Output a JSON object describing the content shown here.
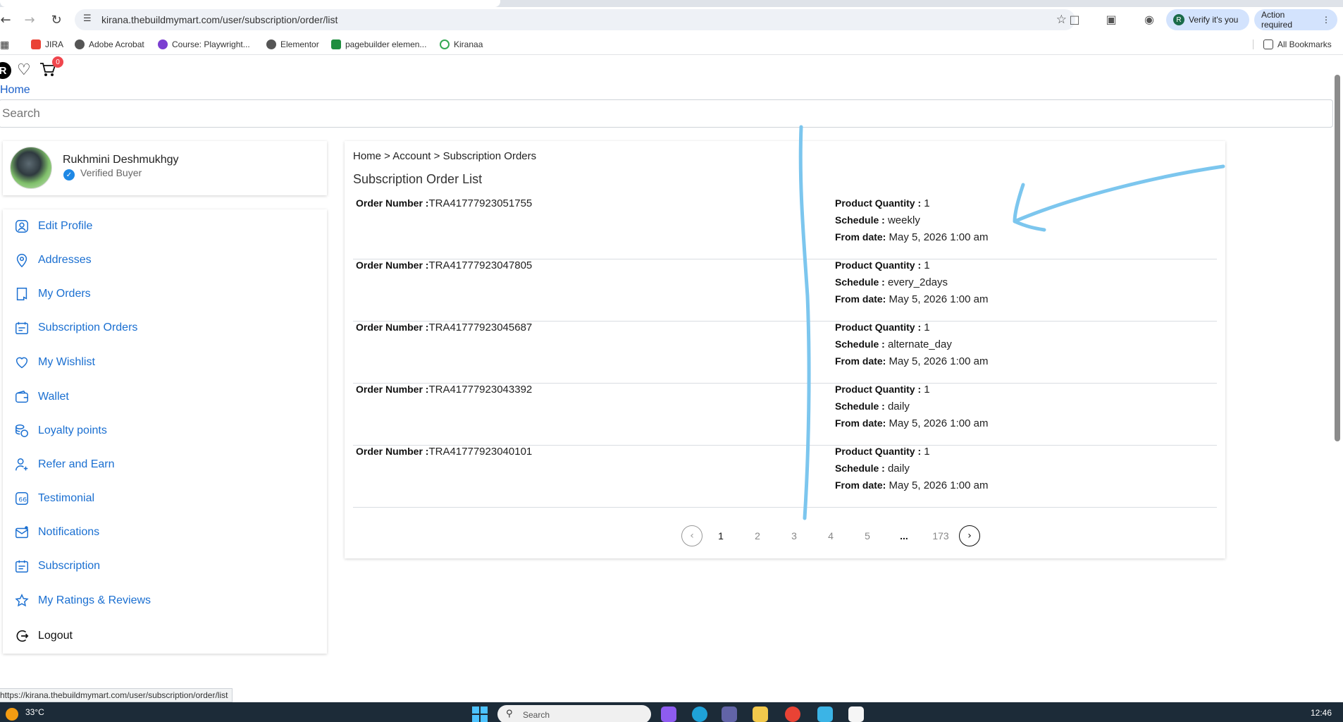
{
  "browser": {
    "url": "kirana.thebuildmymart.com/user/subscription/order/list",
    "verify_label": "Verify it's you",
    "verify_avatar": "R",
    "action_label": "Action required",
    "bookmarks": [
      "JIRA",
      "Adobe Acrobat",
      "Course: Playwright...",
      "Elementor",
      "pagebuilder elemen...",
      "Kiranaa"
    ],
    "all_bookmarks": "All Bookmarks",
    "status_url": "https://kirana.thebuildmymart.com/user/subscription/order/list"
  },
  "header": {
    "logo_letter": "R",
    "cart_count": "0",
    "home_link": "Home",
    "search_placeholder": "Search"
  },
  "profile": {
    "name": "Rukhmini Deshmukhgy",
    "badge": "Verified Buyer"
  },
  "sidebar": {
    "items": [
      {
        "label": "Edit Profile",
        "icon": "user-icon"
      },
      {
        "label": "Addresses",
        "icon": "location-pin-icon"
      },
      {
        "label": "My Orders",
        "icon": "orders-icon"
      },
      {
        "label": "Subscription Orders",
        "icon": "subscription-orders-icon"
      },
      {
        "label": "My Wishlist",
        "icon": "heart-icon"
      },
      {
        "label": "Wallet",
        "icon": "wallet-icon"
      },
      {
        "label": "Loyalty points",
        "icon": "coins-icon"
      },
      {
        "label": "Refer and Earn",
        "icon": "refer-icon"
      },
      {
        "label": "Testimonial",
        "icon": "quote-icon"
      },
      {
        "label": "Notifications",
        "icon": "mail-icon"
      },
      {
        "label": "Subscription",
        "icon": "calendar-icon"
      },
      {
        "label": "My Ratings & Reviews",
        "icon": "star-icon"
      },
      {
        "label": "Logout",
        "icon": "logout-icon"
      }
    ]
  },
  "main": {
    "breadcrumb": "Home > Account > Subscription Orders",
    "title": "Subscription Order List",
    "labels": {
      "order_number": "Order Number :",
      "quantity": "Product Quantity :",
      "schedule": "Schedule :",
      "from_date": "From date:"
    },
    "orders": [
      {
        "number": "TRA41777923051755",
        "quantity": "1",
        "schedule": "weekly",
        "from_date": "May 5, 2026 1:00 am"
      },
      {
        "number": "TRA41777923047805",
        "quantity": "1",
        "schedule": "every_2days",
        "from_date": "May 5, 2026 1:00 am"
      },
      {
        "number": "TRA41777923045687",
        "quantity": "1",
        "schedule": "alternate_day",
        "from_date": "May 5, 2026 1:00 am"
      },
      {
        "number": "TRA41777923043392",
        "quantity": "1",
        "schedule": "daily",
        "from_date": "May 5, 2026 1:00 am"
      },
      {
        "number": "TRA41777923040101",
        "quantity": "1",
        "schedule": "daily",
        "from_date": "May 5, 2026 1:00 am"
      }
    ],
    "pagination": {
      "pages": [
        "1",
        "2",
        "3",
        "4",
        "5",
        "...",
        "173"
      ],
      "current": "1"
    }
  },
  "taskbar": {
    "temperature": "33°C",
    "search_placeholder": "Search",
    "time": "12:46"
  },
  "colors": {
    "link": "#1a6fd1",
    "annotation": "#7cc6ee",
    "badge": "#f0464d"
  }
}
